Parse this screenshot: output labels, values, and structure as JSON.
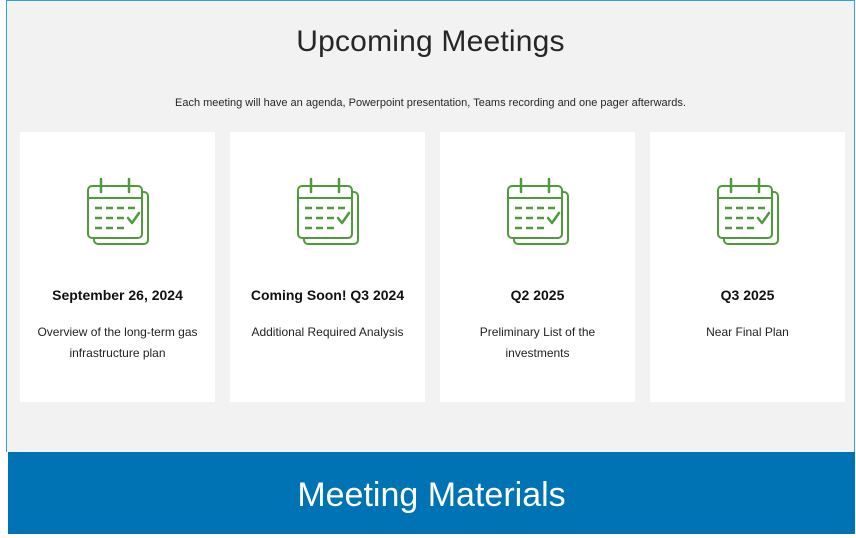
{
  "header": {
    "title": "Upcoming Meetings",
    "subtitle": "Each meeting will have an agenda, Powerpoint presentation, Teams recording and one pager afterwards."
  },
  "cards": [
    {
      "icon": "calendar-check-icon",
      "date": "September 26, 2024",
      "desc": "Overview of the long-term gas infrastructure plan"
    },
    {
      "icon": "calendar-check-icon",
      "date": "Coming Soon! Q3 2024",
      "desc": "Additional Required Analysis"
    },
    {
      "icon": "calendar-check-icon",
      "date": "Q2 2025",
      "desc": "Preliminary List of the investments"
    },
    {
      "icon": "calendar-check-icon",
      "date": "Q3 2025",
      "desc": "Near Final Plan"
    }
  ],
  "banner": {
    "label": "Meeting Materials"
  },
  "colors": {
    "icon": "#4e9a3c",
    "panel": "#f2f2f2",
    "banner": "#0073b5",
    "frame_border": "#2ea3d9"
  }
}
